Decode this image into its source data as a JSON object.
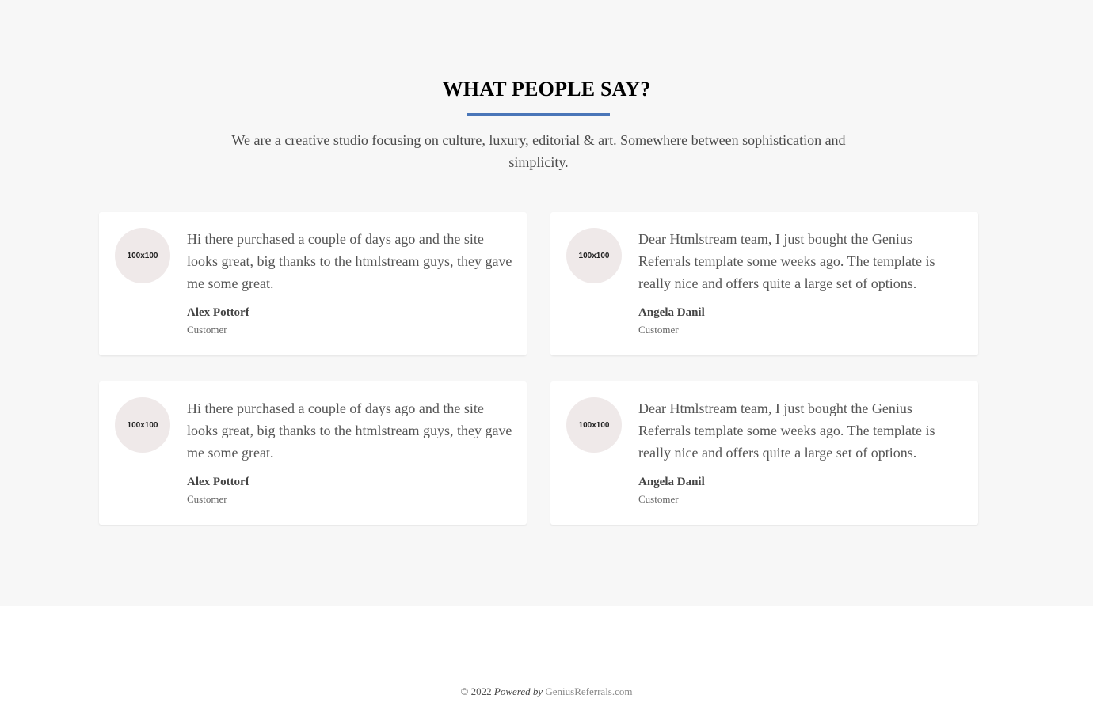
{
  "section": {
    "title": "WHAT PEOPLE SAY?",
    "intro": "We are a creative studio focusing on culture, luxury, editorial & art. Somewhere between sophistication and simplicity.",
    "accent_color": "#4a76b8"
  },
  "testimonials": [
    {
      "avatar": "100x100",
      "quote": "Hi there purchased a couple of days ago and the site looks great, big thanks to the htmlstream guys, they gave me some great.",
      "name": "Alex Pottorf",
      "role": "Customer"
    },
    {
      "avatar": "100x100",
      "quote": "Dear Htmlstream team, I just bought the Genius Referrals template some weeks ago. The template is really nice and offers quite a large set of options.",
      "name": "Angela Danil",
      "role": "Customer"
    },
    {
      "avatar": "100x100",
      "quote": "Hi there purchased a couple of days ago and the site looks great, big thanks to the htmlstream guys, they gave me some great.",
      "name": "Alex Pottorf",
      "role": "Customer"
    },
    {
      "avatar": "100x100",
      "quote": "Dear Htmlstream team, I just bought the Genius Referrals template some weeks ago. The template is really nice and offers quite a large set of options.",
      "name": "Angela Danil",
      "role": "Customer"
    }
  ],
  "footer": {
    "copyright": "© 2022",
    "powered_by": "Powered by",
    "link_text": "GeniusReferrals.com"
  }
}
